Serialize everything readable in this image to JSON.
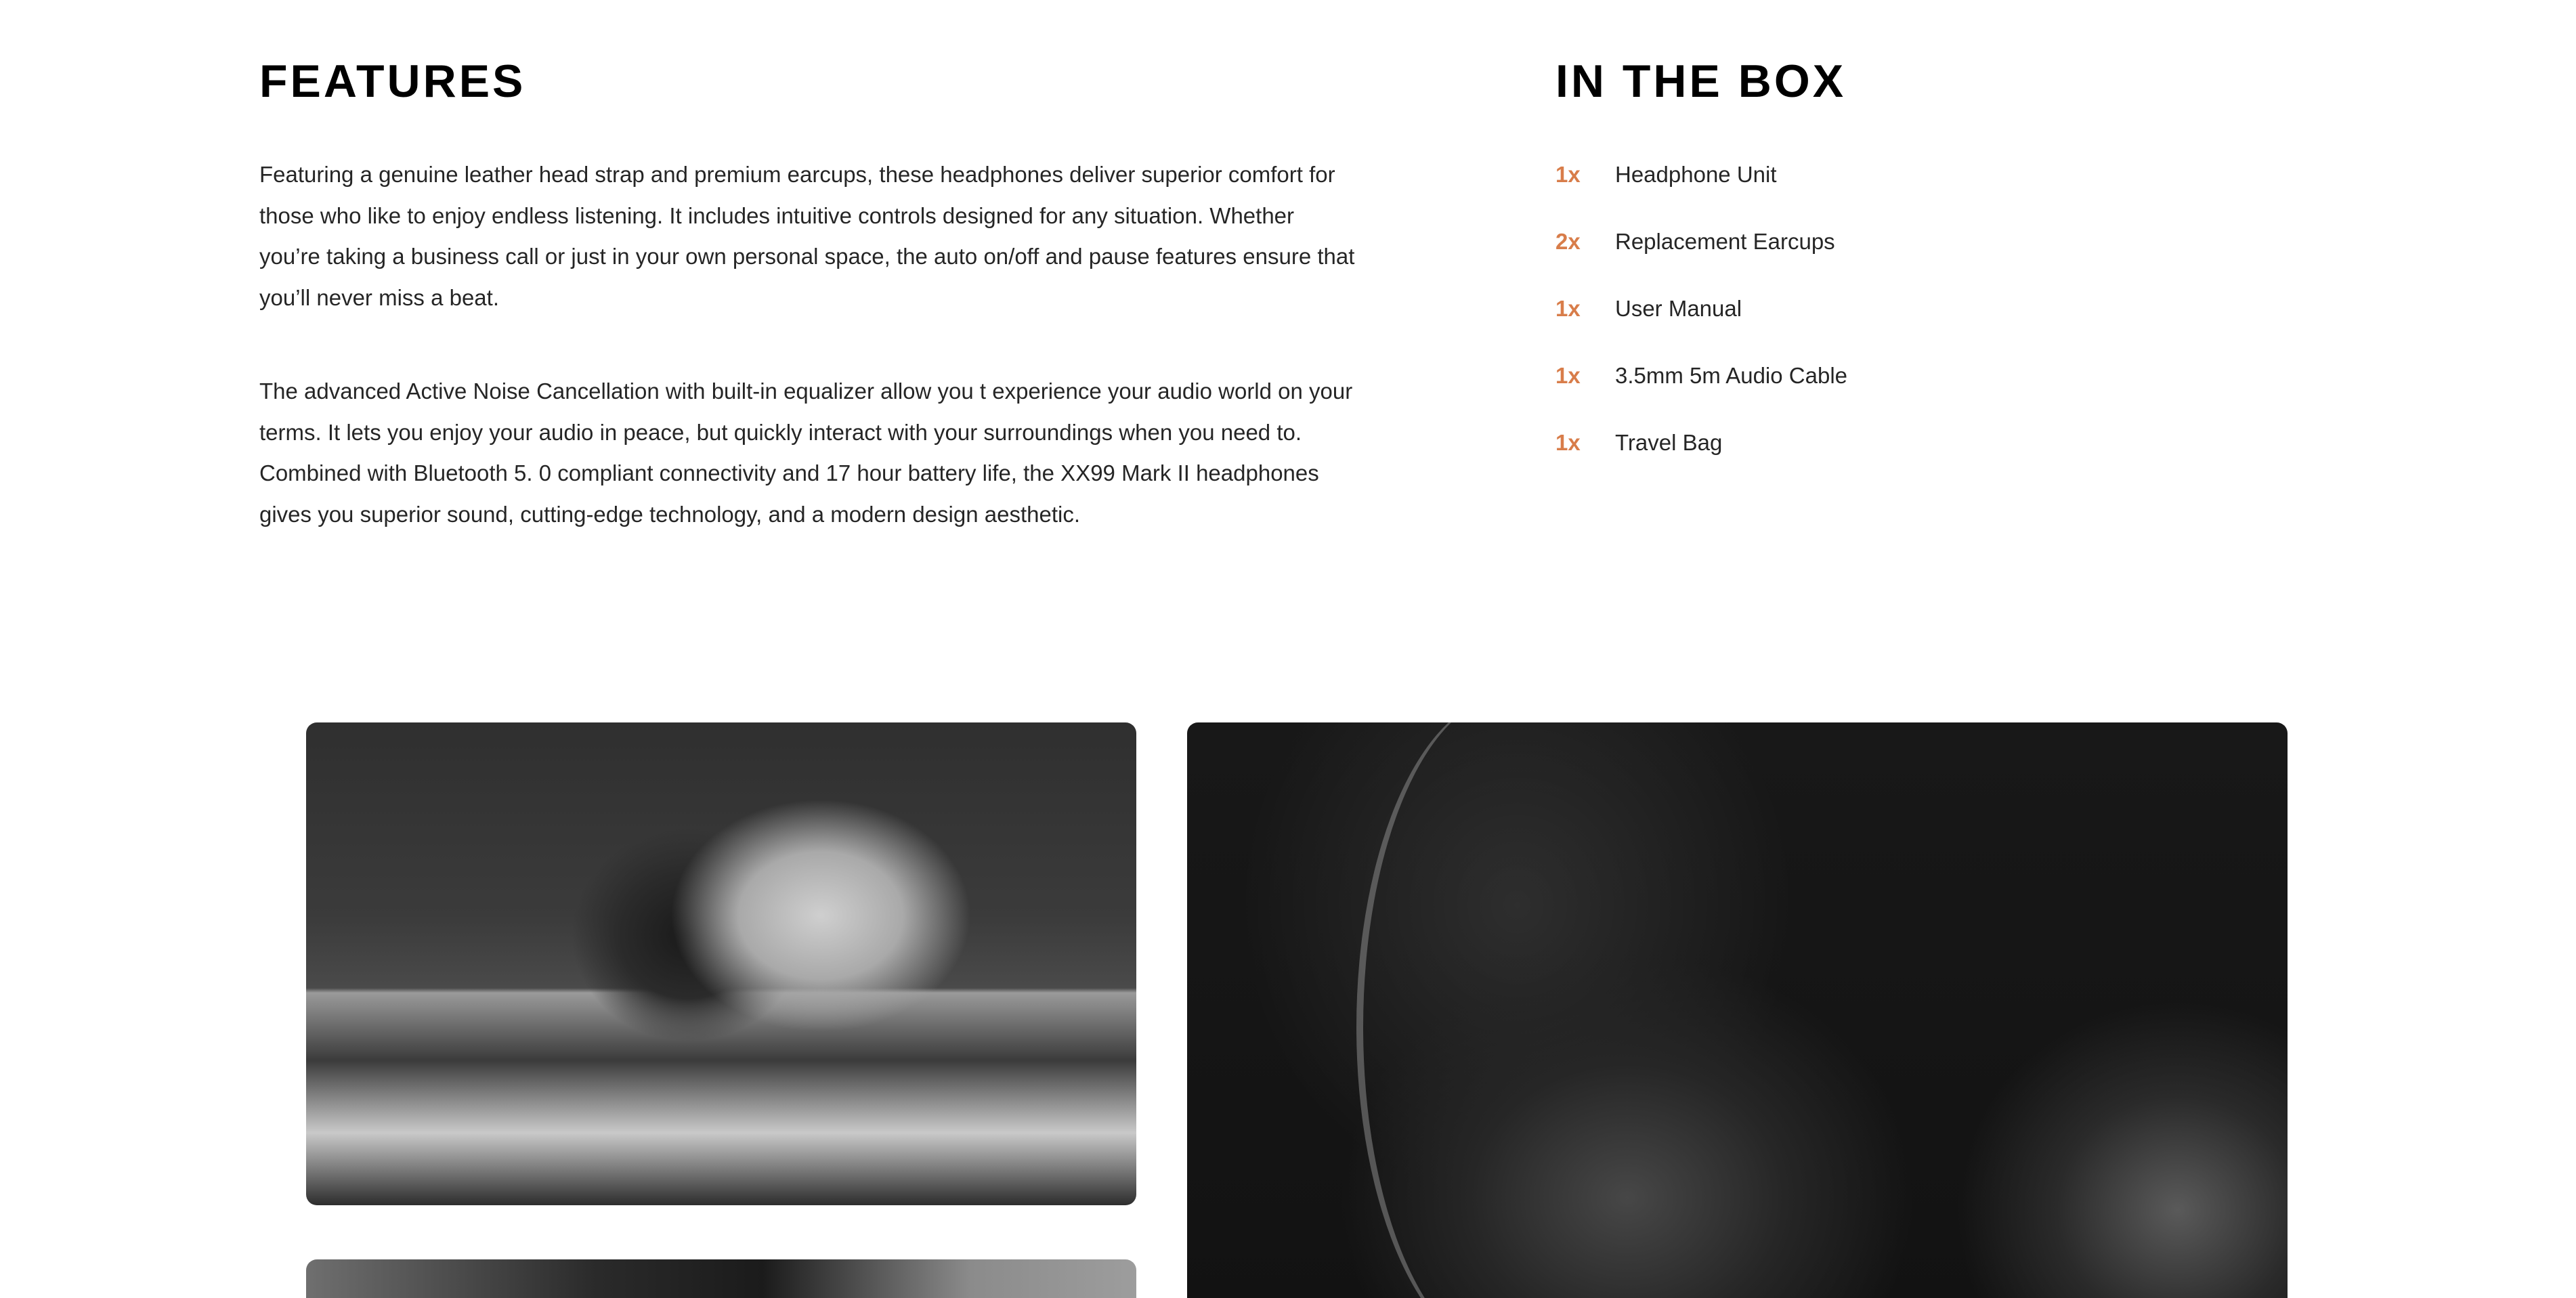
{
  "features": {
    "title": "FEATURES",
    "paragraphs": [
      "Featuring a genuine leather head strap and premium earcups, these headphones deliver superior comfort for those who like to enjoy endless listening. It includes intuitive controls designed for any situation. Whether you’re taking a business call or just in your own personal space, the auto on/off and pause features ensure that you’ll never miss a beat.",
      "The advanced Active Noise Cancellation with built-in equalizer allow you t experience your audio world on your terms. It lets you enjoy your audio in peace, but quickly interact with your surroundings when you need to. Combined with Bluetooth 5. 0 compliant connectivity and 17 hour battery life, the XX99 Mark II headphones gives you superior sound, cutting-edge technology, and a modern design aesthetic."
    ]
  },
  "in_the_box": {
    "title": "IN THE BOX",
    "items": [
      {
        "qty": "1x",
        "name": "Headphone Unit"
      },
      {
        "qty": "2x",
        "name": "Replacement Earcups"
      },
      {
        "qty": "1x",
        "name": "User Manual"
      },
      {
        "qty": "1x",
        "name": "3.5mm 5m Audio Cable"
      },
      {
        "qty": "1x",
        "name": "Travel Bag"
      }
    ]
  },
  "colors": {
    "accent": "#D87D4A",
    "text": "#000000",
    "background": "#FFFFFF"
  }
}
